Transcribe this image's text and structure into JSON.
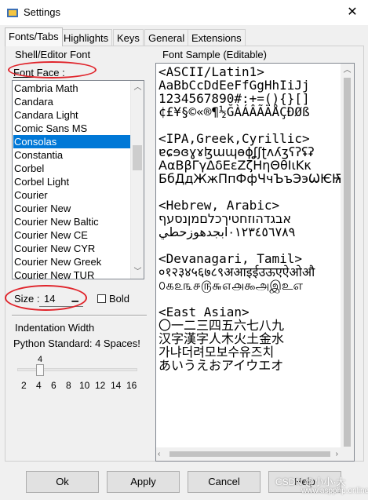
{
  "window": {
    "title": "Settings",
    "close_glyph": "✕",
    "app_icon": "gear-icon"
  },
  "tabs": [
    {
      "label": "Fonts/Tabs",
      "active": true
    },
    {
      "label": "Highlights"
    },
    {
      "label": "Keys"
    },
    {
      "label": "General"
    },
    {
      "label": "Extensions"
    }
  ],
  "font_frame": {
    "title": "Shell/Editor Font",
    "font_face_label": "Font Face :",
    "fonts": [
      "Cambria Math",
      "Candara",
      "Candara Light",
      "Comic Sans MS",
      "Consolas",
      "Constantia",
      "Corbel",
      "Corbel Light",
      "Courier",
      "Courier New",
      "Courier New Baltic",
      "Courier New CE",
      "Courier New CYR",
      "Courier New Greek",
      "Courier New TUR"
    ],
    "selected_font": "Consolas",
    "size_label": "Size :",
    "size_value": "14",
    "bold_label": "Bold",
    "bold_checked": false
  },
  "indent": {
    "title": "Indentation Width",
    "description": "Python Standard: 4 Spaces!",
    "value": "4",
    "ticks": [
      "2",
      "4",
      "6",
      "8",
      "10",
      "12",
      "14",
      "16"
    ]
  },
  "sample": {
    "title": "Font Sample (Editable)",
    "lines": [
      "<ASCII/Latin1>",
      "AaBbCcDdEeFfGgHhIiJj",
      "1234567890#:+=(){}[]",
      "¢£¥§©«®¶½ĞÀÁÂÃÄÅÇÐØß",
      "",
      "<IPA,Greek,Cyrillic>",
      "ɐɕɘɞɣɤɮɯɰɵɸʆʃʈʌʎʒʕʔʢʡ",
      "ΑαΒβΓγΔδΕεΖζΗηΘθΙιΚκ",
      "БбДдЖжПпФфЧчЪъЭэѠѤѬѪ",
      "",
      "<Hebrew, Arabic>",
      "אבגדהוזחטיךכלםמןנסעף",
      "٠١٢٣٤٥٦٧٨٩ابجدهوزحطي",
      "",
      "<Devanagari, Tamil>",
      "०१२३४५६७८९अआइईउऊएऐओऔ",
      "௦௧௨௩௪௫௬௭௮௯அஇஉஎ",
      "",
      "<East Asian>",
      "〇一二三四五六七八九",
      "汉字漢字人木火土金水",
      "가냐더려모보수유즈치",
      "あいうえおアイウエオ"
    ]
  },
  "buttons": {
    "ok": "Ok",
    "apply": "Apply",
    "cancel": "Cancel",
    "help": "Help"
  },
  "watermark": {
    "line1": "CSDN @小小·大",
    "line2": "www.aspphp.online"
  },
  "colors": {
    "selection": "#0078d7",
    "annotation": "#e0242b"
  }
}
